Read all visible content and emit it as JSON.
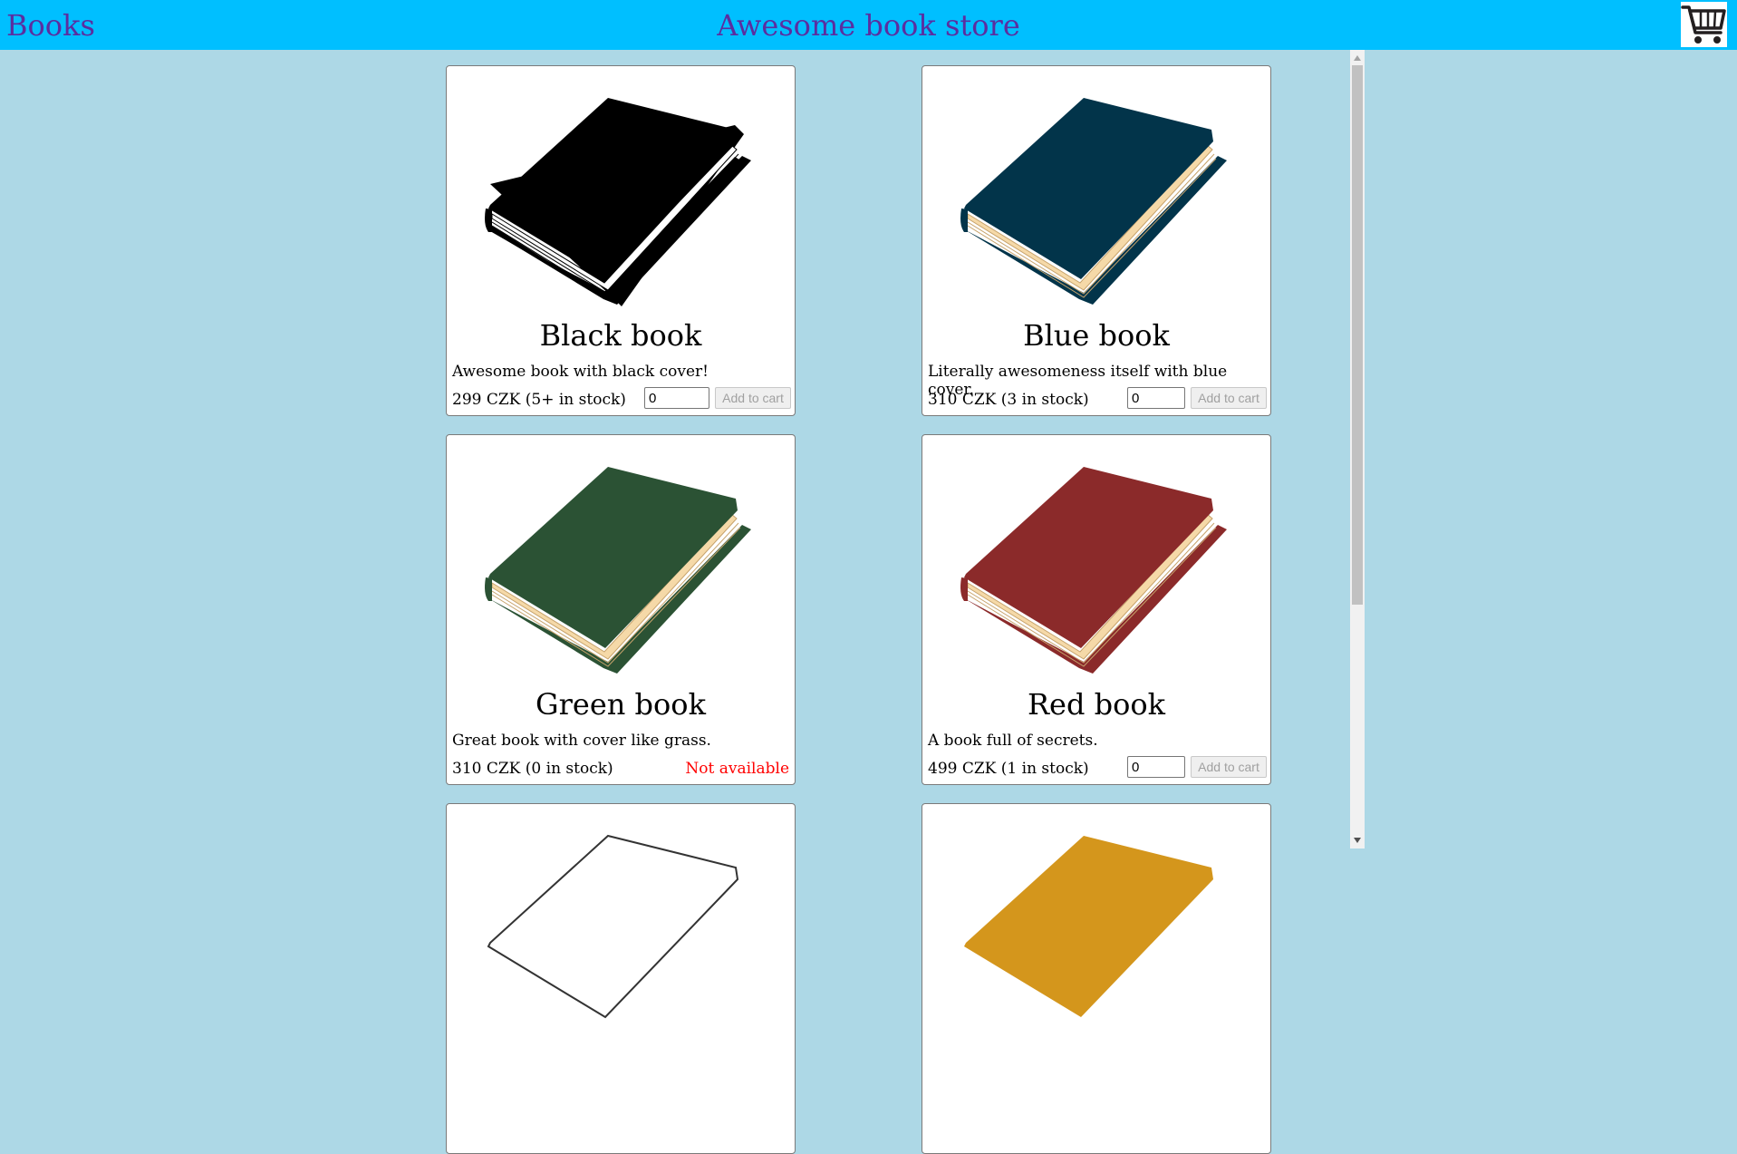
{
  "header": {
    "brand": "Books",
    "title": "Awesome book store",
    "cart_icon": "shopping-cart-icon"
  },
  "products": [
    {
      "title": "Black book",
      "description": "Awesome book with black cover!",
      "price": "299 CZK (5+ in stock)",
      "qty": "0",
      "action": "Add to cart",
      "cover_color": "#000000"
    },
    {
      "title": "Blue book",
      "description": "Literally awesomeness itself with blue cover.",
      "price": "310 CZK (3 in stock)",
      "qty": "0",
      "action": "Add to cart",
      "cover_color": "#02344a"
    },
    {
      "title": "Green book",
      "description": "Great book with cover like grass.",
      "price": "310 CZK (0 in stock)",
      "status": "Not available",
      "cover_color": "#2b5234"
    },
    {
      "title": "Red book",
      "description": "A book full of secrets.",
      "price": "499 CZK (1 in stock)",
      "qty": "0",
      "action": "Add to cart",
      "cover_color": "#8b2a2a"
    },
    {
      "title": "",
      "cover_color": "#ffffff"
    },
    {
      "title": "",
      "cover_color": "#d4961c"
    }
  ],
  "colors": {
    "header_bg": "#00bfff",
    "page_bg": "#add8e6",
    "header_text": "#5b2ea0",
    "unavailable": "#ff0000"
  }
}
